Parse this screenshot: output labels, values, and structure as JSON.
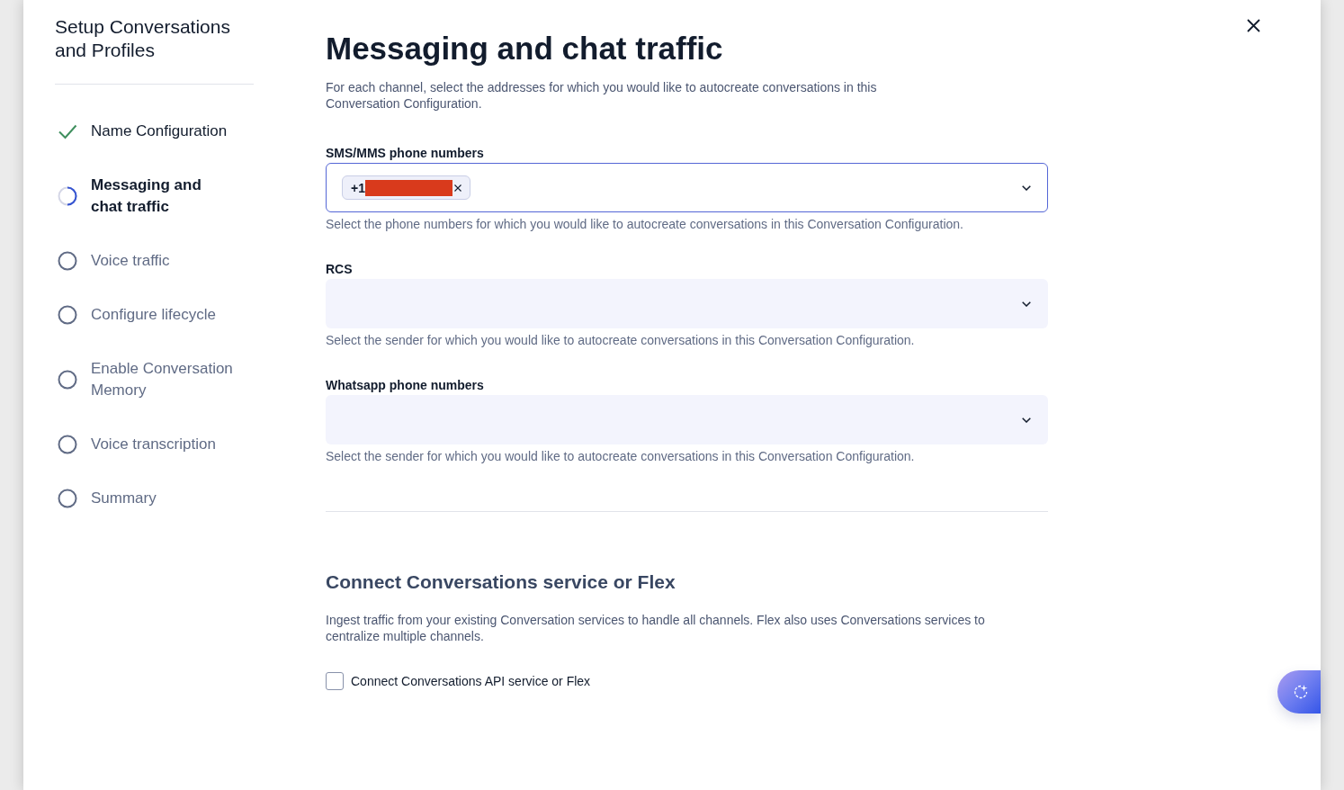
{
  "sidebar": {
    "title": "Setup Conversations and Profiles",
    "steps": [
      {
        "label": "Name Configuration",
        "completed": true,
        "selected": false
      },
      {
        "label": "Messaging and chat traffic",
        "completed": false,
        "selected": true
      },
      {
        "label": "Voice traffic",
        "completed": false,
        "selected": false
      },
      {
        "label": "Configure lifecycle",
        "completed": false,
        "selected": false
      },
      {
        "label": "Enable Conversation Memory",
        "completed": false,
        "selected": false
      },
      {
        "label": "Voice transcription",
        "completed": false,
        "selected": false
      },
      {
        "label": "Summary",
        "completed": false,
        "selected": false
      }
    ]
  },
  "main": {
    "title": "Messaging and chat traffic",
    "description": "For each channel, select the addresses for which you would like to autocreate conversations in this Conversation Configuration.",
    "fields": [
      {
        "label": "SMS/MMS phone numbers",
        "focused": true,
        "chips": [
          {
            "text": "+1",
            "redacted": true
          }
        ],
        "help": "Select the phone numbers for which you would like to autocreate conversations in this Conversation Configuration."
      },
      {
        "label": "RCS",
        "focused": false,
        "help": "Select the sender for which you would like to autocreate conversations in this Conversation Configuration."
      },
      {
        "label": "Whatsapp phone numbers",
        "focused": false,
        "help": "Select the sender for which you would like to autocreate conversations in this Conversation Configuration."
      }
    ]
  },
  "connect_section": {
    "title": "Connect Conversations service or Flex",
    "description": "Ingest traffic from your existing Conversation services to handle all channels. Flex also uses Conversations services to centralize multiple channels.",
    "checkbox": {
      "label": "Connect Conversations API service or Flex",
      "checked": false
    }
  }
}
